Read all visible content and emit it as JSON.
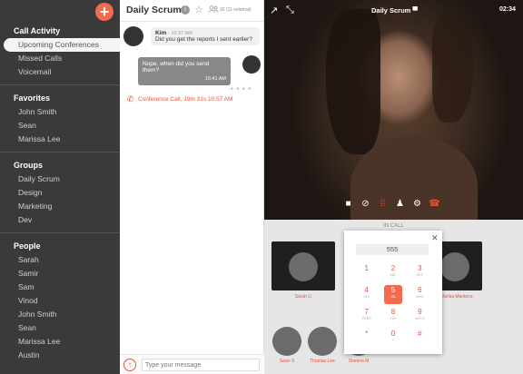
{
  "sidebar": {
    "add_label": "+",
    "sections": [
      {
        "title": "Call Activity",
        "items": [
          {
            "label": "Upcoming Conferences",
            "active": true
          },
          {
            "label": "Missed Calls"
          },
          {
            "label": "Voicemail"
          }
        ]
      },
      {
        "title": "Favorites",
        "items": [
          {
            "label": "John Smith"
          },
          {
            "label": "Sean"
          },
          {
            "label": "Marissa Lee"
          }
        ]
      },
      {
        "title": "Groups",
        "items": [
          {
            "label": "Daily Scrum"
          },
          {
            "label": "Design"
          },
          {
            "label": "Marketing"
          },
          {
            "label": "Dev"
          }
        ]
      },
      {
        "title": "People",
        "items": [
          {
            "label": "Sarah"
          },
          {
            "label": "Samir"
          },
          {
            "label": "Sam"
          },
          {
            "label": "Vinod"
          },
          {
            "label": "John Smith"
          },
          {
            "label": "Sean"
          },
          {
            "label": "Marissa Lee"
          },
          {
            "label": "Austin"
          }
        ]
      }
    ]
  },
  "chat": {
    "title": "Daily Scrum",
    "participants": "32 (11 external)",
    "messages": {
      "incoming": {
        "from": "Kim",
        "time": "- 10:37 AM",
        "text": "Did you get the reports I sent earlier?"
      },
      "outgoing": {
        "text": "Nope, when did you send them?",
        "time": "10:41 AM"
      }
    },
    "call_log": {
      "text": "Conference Call, 19m 31s",
      "time": "10:57 AM"
    },
    "input_placeholder": "Type your message"
  },
  "video": {
    "title": "Daily Scrum",
    "clock": "02:34"
  },
  "incall": {
    "label": "IN CALL",
    "participants": [
      {
        "name": "Sarah Li"
      },
      {
        "name": "Marisa Manteca"
      },
      {
        "name": "Sean S"
      },
      {
        "name": "Thomas Lee"
      },
      {
        "name": "Sheena M"
      }
    ]
  },
  "dialpad": {
    "display": "555",
    "keys": [
      {
        "digit": "1",
        "letters": ""
      },
      {
        "digit": "2",
        "letters": "ABC"
      },
      {
        "digit": "3",
        "letters": "DEF"
      },
      {
        "digit": "4",
        "letters": "GHI"
      },
      {
        "digit": "5",
        "letters": "JKL",
        "pressed": true
      },
      {
        "digit": "6",
        "letters": "MNO"
      },
      {
        "digit": "7",
        "letters": "PQRS"
      },
      {
        "digit": "8",
        "letters": "TUV"
      },
      {
        "digit": "9",
        "letters": "WXYZ"
      },
      {
        "digit": "*",
        "letters": ""
      },
      {
        "digit": "0",
        "letters": "+"
      },
      {
        "digit": "#",
        "letters": ""
      }
    ]
  },
  "colors": {
    "accent": "#e8533a",
    "sidebar": "#3a3a3a"
  }
}
